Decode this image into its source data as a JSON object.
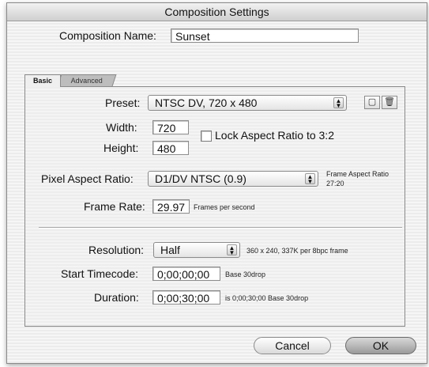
{
  "window": {
    "title": "Composition Settings"
  },
  "composition_name": {
    "label": "Composition Name:",
    "value": "Sunset"
  },
  "tabs": [
    {
      "label": "Basic"
    },
    {
      "label": "Advanced"
    }
  ],
  "basic": {
    "preset": {
      "label": "Preset:",
      "value": "NTSC DV, 720 x 480",
      "save_icon": "save-preset-icon",
      "delete_icon": "trash-icon"
    },
    "width": {
      "label": "Width:",
      "value": "720"
    },
    "height": {
      "label": "Height:",
      "value": "480"
    },
    "lock_aspect": {
      "label": "Lock Aspect Ratio to 3:2",
      "checked": false
    },
    "pixel_aspect": {
      "label": "Pixel Aspect Ratio:",
      "value": "D1/DV NTSC (0.9)"
    },
    "frame_aspect": {
      "label": "Frame Aspect Ratio",
      "value": "27:20"
    },
    "frame_rate": {
      "label": "Frame Rate:",
      "value": "29.97",
      "unit": "Frames per second"
    },
    "resolution": {
      "label": "Resolution:",
      "value": "Half",
      "info": "360 x 240, 337K per 8bpc frame"
    },
    "start_timecode": {
      "label": "Start Timecode:",
      "value": "0;00;00;00",
      "base": "Base 30drop"
    },
    "duration": {
      "label": "Duration:",
      "value": "0;00;30;00",
      "info": "is 0;00;30;00  Base 30drop"
    }
  },
  "buttons": {
    "cancel": "Cancel",
    "ok": "OK"
  }
}
